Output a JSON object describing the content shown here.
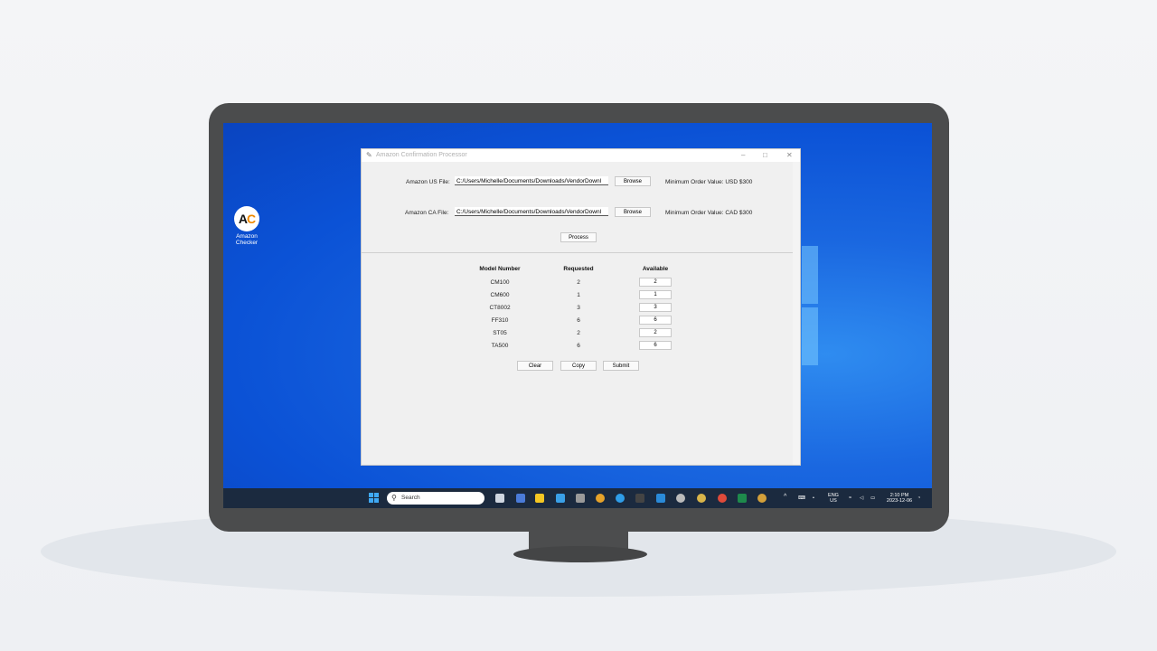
{
  "desktop": {
    "icon_label": "Amazon Checker",
    "icon_logo_text": "AC"
  },
  "window": {
    "title": "Amazon Confirmation Processor",
    "us_label": "Amazon US File:",
    "us_path": "C:/Users/Michelle/Documents/Downloads/VendorDownl",
    "us_browse": "Browse",
    "us_min": "Minimum Order Value: USD $300",
    "ca_label": "Amazon CA File:",
    "ca_path": "C:/Users/Michelle/Documents/Downloads/VendorDownl",
    "ca_browse": "Browse",
    "ca_min": "Minimum Order Value: CAD $300",
    "process": "Process"
  },
  "table": {
    "headers": [
      "Model Number",
      "Requested",
      "Available"
    ],
    "rows": [
      {
        "model": "CM100",
        "requested": "2",
        "available": "2"
      },
      {
        "model": "CM600",
        "requested": "1",
        "available": "1"
      },
      {
        "model": "CT8002",
        "requested": "3",
        "available": "3"
      },
      {
        "model": "FF310",
        "requested": "6",
        "available": "6"
      },
      {
        "model": "ST05",
        "requested": "2",
        "available": "2"
      },
      {
        "model": "TA500",
        "requested": "6",
        "available": "6"
      }
    ]
  },
  "actions": {
    "clear": "Clear",
    "copy": "Copy",
    "submit": "Submit"
  },
  "taskbar": {
    "search_placeholder": "Search",
    "lang_top": "ENG",
    "lang_bottom": "US",
    "time": "2:10 PM",
    "date": "2023-12-06"
  },
  "colors": {
    "accent": "#0b52d6",
    "taskbar": "#1b2a3f",
    "logo_c": "#f08a00"
  }
}
